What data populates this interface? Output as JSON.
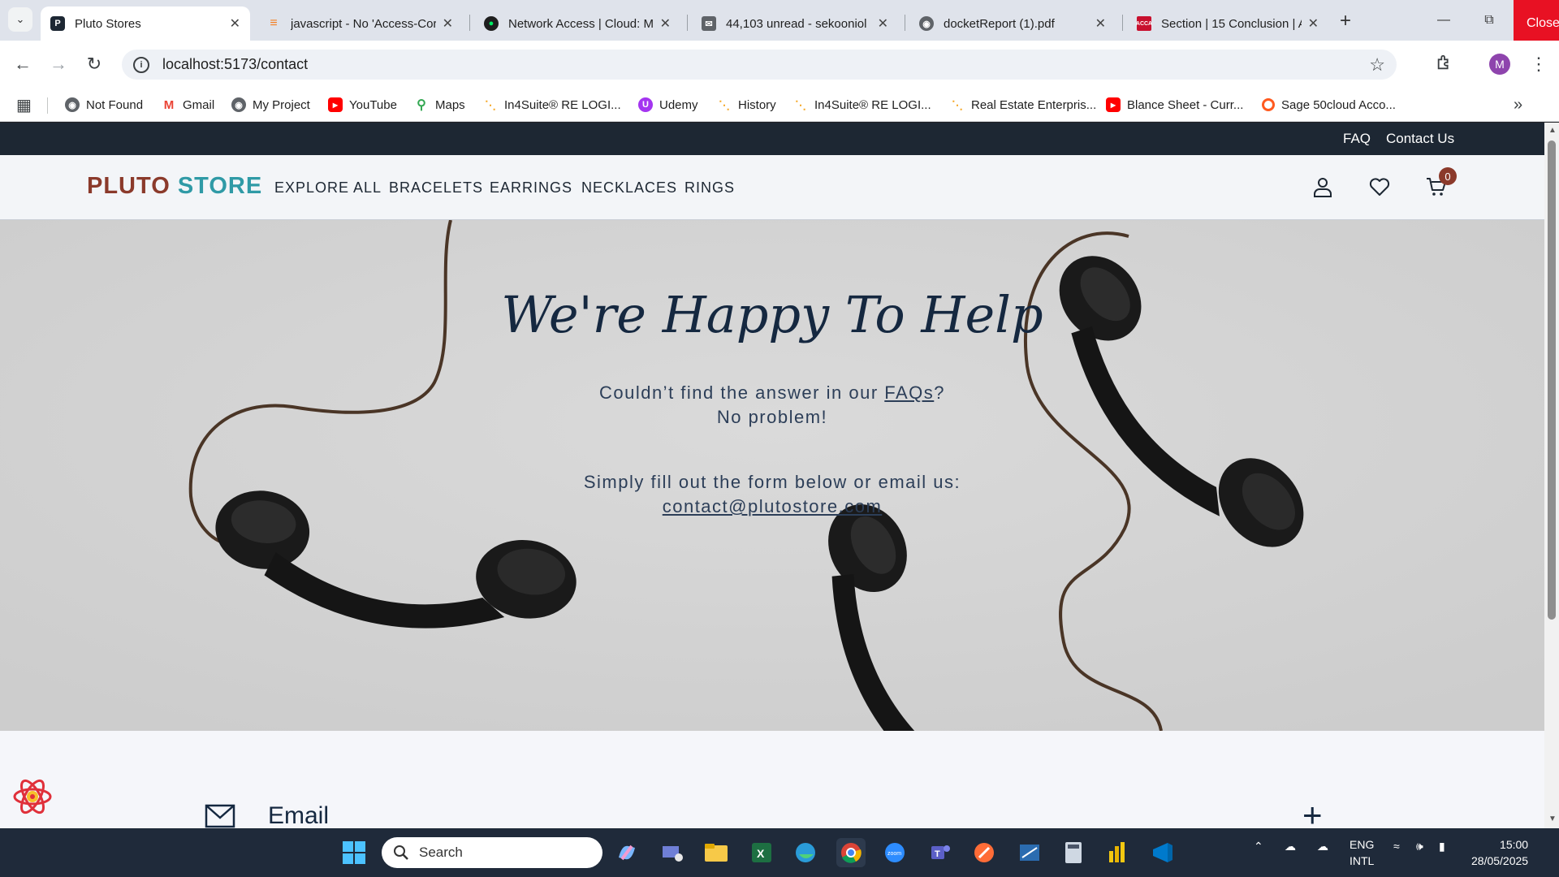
{
  "browser": {
    "tabs": [
      {
        "title": "Pluto Stores",
        "active": true,
        "icon": "pluto-p-icon",
        "color": "#1d2733"
      },
      {
        "title": "javascript - No 'Access-Cor",
        "active": false,
        "icon": "stackoverflow-icon",
        "color": "#f48024"
      },
      {
        "title": "Network Access | Cloud: M",
        "active": false,
        "icon": "mongodb-leaf-icon",
        "color": "#00684a"
      },
      {
        "title": "44,103 unread - sekooniol",
        "active": false,
        "icon": "mail-folder-icon",
        "color": "#5f6368"
      },
      {
        "title": "docketReport (1).pdf",
        "active": false,
        "icon": "globe-icon",
        "color": "#5f6368"
      },
      {
        "title": "Section | 15 Conclusion | A",
        "active": false,
        "icon": "acca-icon",
        "color": "#c8102e"
      }
    ],
    "close_label": "Close",
    "url": "localhost:5173/contact",
    "profile_initial": "M",
    "bookmarks": [
      {
        "label": "Not Found",
        "icon": "globe-icon",
        "color": "#5f6368"
      },
      {
        "label": "Gmail",
        "icon": "gmail-icon",
        "color": "#ea4335"
      },
      {
        "label": "My Project",
        "icon": "globe-icon",
        "color": "#5f6368"
      },
      {
        "label": "YouTube",
        "icon": "youtube-icon",
        "color": "#ff0000"
      },
      {
        "label": "Maps",
        "icon": "maps-pin-icon",
        "color": "#34a853"
      },
      {
        "label": "In4Suite® RE LOGI...",
        "icon": "chart-sparkle-icon",
        "color": "#f5a623"
      },
      {
        "label": "Udemy",
        "icon": "udemy-icon",
        "color": "#a435f0"
      },
      {
        "label": "History",
        "icon": "chart-sparkle-icon",
        "color": "#f5a623"
      },
      {
        "label": "In4Suite® RE LOGI...",
        "icon": "chart-sparkle-icon",
        "color": "#f5a623"
      },
      {
        "label": "Real Estate Enterpris...",
        "icon": "chart-sparkle-icon",
        "color": "#f5a623"
      },
      {
        "label": "Blance Sheet - Curr...",
        "icon": "youtube-icon",
        "color": "#ff0000"
      },
      {
        "label": "Sage 50cloud Acco...",
        "icon": "sage-icon",
        "color": "#ff5a1f"
      }
    ]
  },
  "site": {
    "topbar": {
      "faq": "FAQ",
      "contact": "Contact Us"
    },
    "logo": {
      "part1": "PLUTO",
      "part2": "STORE"
    },
    "nav": [
      "EXPLORE ALL",
      "BRACELETS",
      "EARRINGS",
      "NECKLACES",
      "RINGS"
    ],
    "cart_count": "0",
    "hero": {
      "title": "We're Happy To Help",
      "line1_prefix": "Couldn’t find the answer in our ",
      "line1_link": "FAQs",
      "line1_suffix": "?",
      "line2": "No problem!",
      "line3": "Simply fill out the form below or email us:",
      "email": "contact@plutostore.com"
    },
    "contact_section": {
      "email_label": "Email"
    },
    "colors": {
      "brand_dark": "#1d2733",
      "logo_red": "#8b3a2b",
      "logo_teal": "#2f9aa6",
      "heading": "#152840"
    }
  },
  "taskbar": {
    "search_placeholder": "Search",
    "lang1": "ENG",
    "lang2": "INTL",
    "time": "15:00",
    "date": "28/05/2025",
    "apps": [
      "windows-start-icon",
      "copilot-icon",
      "teams-meet-icon",
      "file-explorer-icon",
      "excel-icon",
      "edge-icon",
      "chrome-icon",
      "zoom-icon",
      "teams-icon",
      "postman-icon",
      "ssms-icon",
      "calculator-icon",
      "powerbi-icon",
      "vscode-icon"
    ]
  }
}
